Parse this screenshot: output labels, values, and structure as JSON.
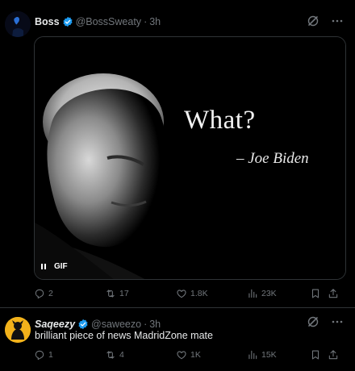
{
  "tweets": [
    {
      "author_name": "Boss",
      "handle": "@BossSweaty",
      "separator": "·",
      "time": "3h",
      "media": {
        "quote": "What?",
        "attribution": "– Joe Biden",
        "badge": "GIF"
      },
      "stats": {
        "replies": "2",
        "retweets": "17",
        "likes": "1.8K",
        "views": "23K"
      }
    },
    {
      "author_name": "Saqeezy",
      "handle": "@saweezo",
      "separator": "·",
      "time": "3h",
      "text": "brilliant piece of news MadridZone mate",
      "stats": {
        "replies": "1",
        "retweets": "4",
        "likes": "1K",
        "views": "15K"
      }
    }
  ],
  "colors": {
    "background": "#000000",
    "text": "#e7e9ea",
    "muted": "#71767b",
    "verified": "#1d9bf0",
    "divider": "#2f3336",
    "avatar2": "#f2b21b"
  },
  "icons": [
    "grok-icon",
    "more-icon",
    "reply-icon",
    "retweet-icon",
    "like-icon",
    "views-icon",
    "bookmark-icon",
    "share-icon",
    "verified-badge-icon",
    "pause-icon"
  ]
}
